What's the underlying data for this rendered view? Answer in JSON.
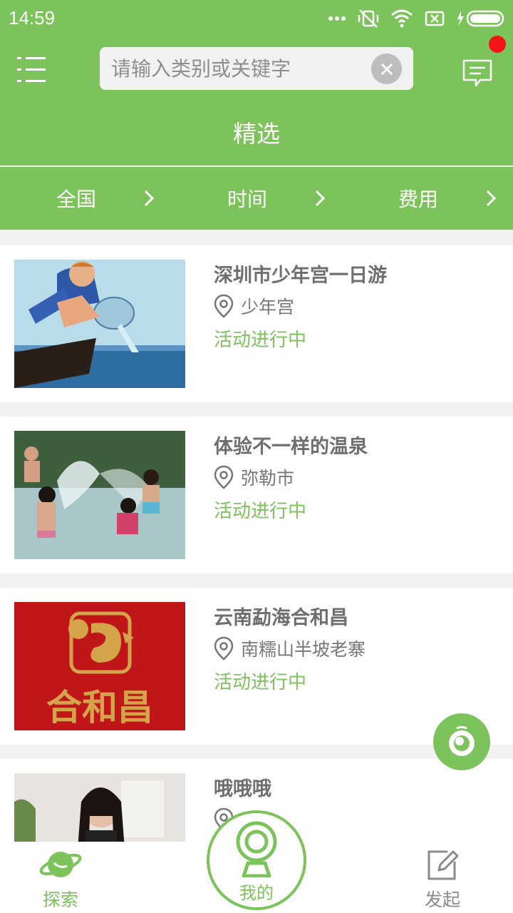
{
  "status_bar": {
    "time": "14:59"
  },
  "search": {
    "placeholder": "请输入类别或关键字"
  },
  "header": {
    "title": "精选"
  },
  "filters": [
    {
      "label": "全国"
    },
    {
      "label": "时间"
    },
    {
      "label": "费用"
    }
  ],
  "items": [
    {
      "name": "深圳市少年宫一日游",
      "location": "少年宫",
      "status": "活动进行中"
    },
    {
      "name": "体验不一样的温泉",
      "location": "弥勒市",
      "status": "活动进行中"
    },
    {
      "name": "云南勐海合和昌",
      "location": "南糯山半坡老寨",
      "status": "活动进行中"
    },
    {
      "name": "哦哦哦",
      "location": "",
      "status": ""
    }
  ],
  "logo_text": "合和昌",
  "bottom_nav": {
    "explore": "探索",
    "mine": "我的",
    "create": "发起"
  },
  "colors": {
    "primary": "#7dc35b",
    "badge": "#f2161b",
    "logo_red": "#c0161a",
    "logo_gold": "#d3a449"
  }
}
